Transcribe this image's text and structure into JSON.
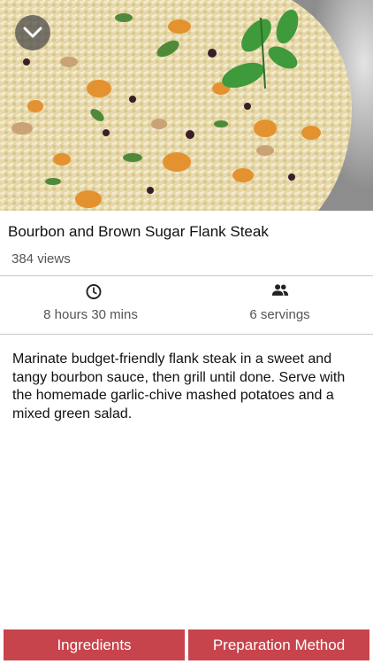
{
  "hero": {
    "collapse_icon": "chevron-down-icon",
    "image_subject": "couscous salad with apricots and mint"
  },
  "recipe": {
    "title": "Bourbon and Brown Sugar Flank Steak",
    "views": "384 views",
    "time": "8 hours 30 mins",
    "servings": "6 servings",
    "description": "Marinate budget-friendly flank steak in a sweet and tangy bourbon sauce, then grill until done.  Serve with the homemade garlic-chive mashed potatoes and a mixed green salad."
  },
  "icons": {
    "time": "clock-icon",
    "servings": "people-icon"
  },
  "tabs": {
    "ingredients": "Ingredients",
    "method": "Preparation Method"
  },
  "colors": {
    "tab_background": "#c8444c",
    "tab_text": "#ffffff",
    "divider": "#c8c8c8"
  }
}
